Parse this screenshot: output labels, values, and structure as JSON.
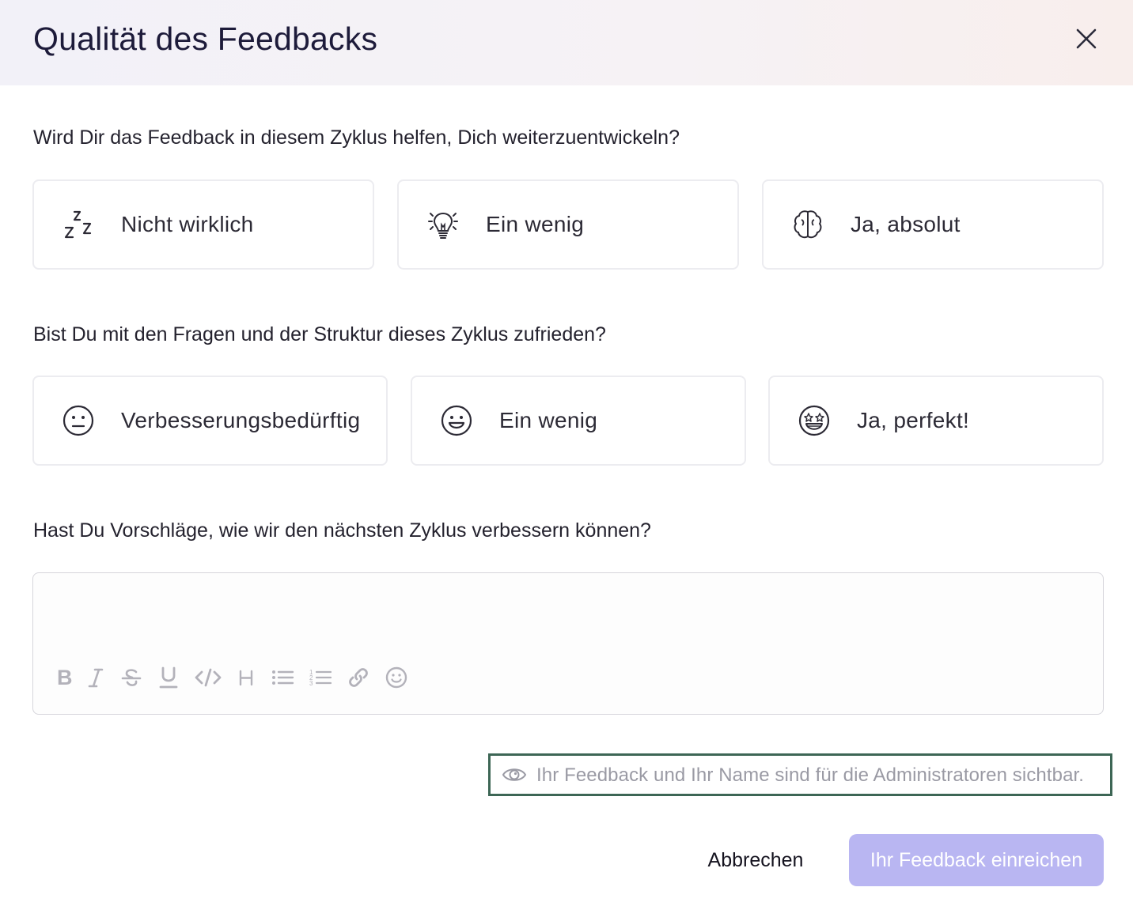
{
  "dialog": {
    "title": "Qualität des Feedbacks",
    "close_icon": "close-icon"
  },
  "questions": [
    {
      "text": "Wird Dir das Feedback in diesem Zyklus helfen, Dich weiterzuentwickeln?",
      "options": [
        {
          "label": "Nicht wirklich",
          "icon": "sleep-zzz-icon"
        },
        {
          "label": "Ein wenig",
          "icon": "lightbulb-icon"
        },
        {
          "label": "Ja, absolut",
          "icon": "brain-icon"
        }
      ]
    },
    {
      "text": "Bist Du mit den Fragen und der Struktur dieses Zyklus zufrieden?",
      "options": [
        {
          "label": "Verbesserungsbedürftig",
          "icon": "neutral-face-icon"
        },
        {
          "label": "Ein wenig",
          "icon": "smiling-face-icon"
        },
        {
          "label": "Ja, perfekt!",
          "icon": "star-struck-face-icon"
        }
      ]
    },
    {
      "text": "Hast Du Vorschläge, wie wir den nächsten Zyklus verbessern können?"
    }
  ],
  "editor": {
    "value": "",
    "toolbar": [
      "bold-icon",
      "italic-icon",
      "strikethrough-icon",
      "underline-icon",
      "code-icon",
      "heading-icon",
      "bullet-list-icon",
      "numbered-list-icon",
      "link-icon",
      "emoji-icon"
    ]
  },
  "visibility_notice": {
    "icon": "eye-icon",
    "text": "Ihr Feedback und Ihr Name sind für die Administratoren sichtbar."
  },
  "actions": {
    "cancel": "Abbrechen",
    "submit": "Ihr Feedback einreichen"
  },
  "colors": {
    "submit_bg": "#b9b6f2",
    "notice_border": "#3d6655",
    "title": "#1d1b3a"
  }
}
